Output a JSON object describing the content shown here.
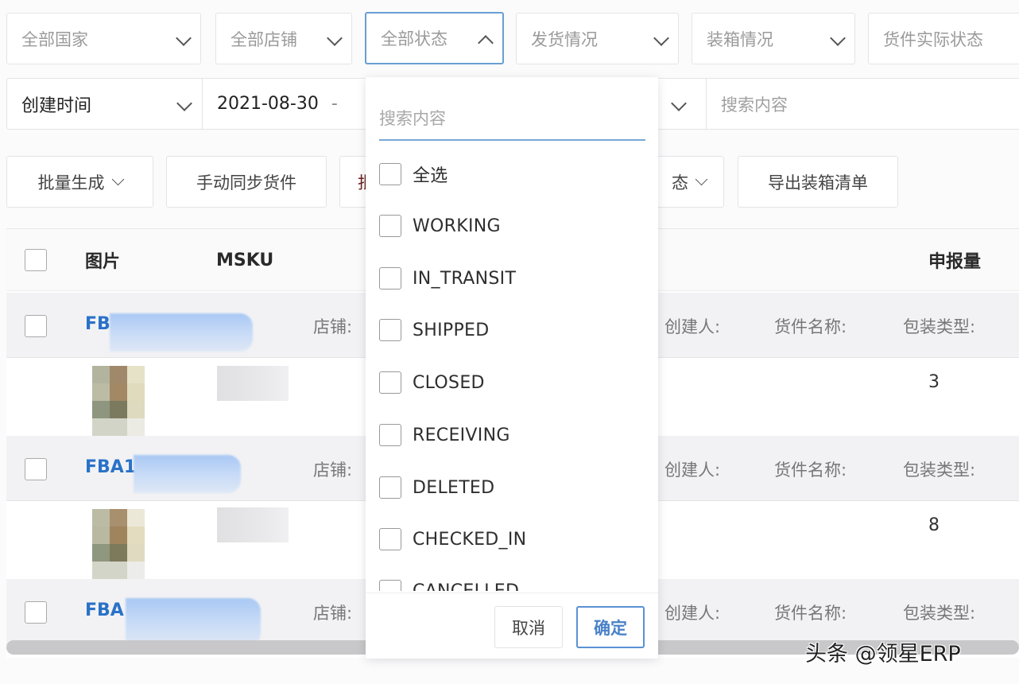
{
  "filters_row1": [
    {
      "label": "全部国家",
      "open": false
    },
    {
      "label": "全部店铺",
      "open": false
    },
    {
      "label": "全部状态",
      "open": true
    },
    {
      "label": "发货情况",
      "open": false
    },
    {
      "label": "装箱情况",
      "open": false
    },
    {
      "label": "货件实际状态",
      "open": false
    }
  ],
  "filters_row2": {
    "time_type": "创建时间",
    "date_start": "2021-08-30",
    "date_separator": "-",
    "search_placeholder": "搜索内容"
  },
  "toolbar": {
    "batch_generate": "批量生成",
    "manual_sync": "手动同步货件",
    "third_partial": "批",
    "status_partial": "态",
    "export_packing": "导出装箱清单"
  },
  "table": {
    "headers": {
      "image": "图片",
      "msku": "MSKU",
      "declared_qty": "申报量"
    },
    "groups": [
      {
        "shipment_id_prefix": "FB",
        "store_label": "店铺:",
        "creator_label": "创建人:",
        "shipment_name_label": "货件名称:",
        "package_type_label": "包装类型:",
        "declared_qty": "3"
      },
      {
        "shipment_id_prefix": "FBA1",
        "store_label": "店铺:",
        "creator_label": "创建人:",
        "shipment_name_label": "货件名称:",
        "package_type_label": "包装类型:",
        "declared_qty": "8"
      },
      {
        "shipment_id_prefix": "FBA",
        "store_label": "店铺:",
        "creator_label": "创建人:",
        "shipment_name_label": "货件名称:",
        "package_type_label": "包装类型:"
      }
    ]
  },
  "status_dropdown": {
    "search_placeholder": "搜索内容",
    "options": [
      {
        "label": "全选",
        "checked": false
      },
      {
        "label": "WORKING",
        "checked": false
      },
      {
        "label": "IN_TRANSIT",
        "checked": false
      },
      {
        "label": "SHIPPED",
        "checked": false
      },
      {
        "label": "CLOSED",
        "checked": false
      },
      {
        "label": "RECEIVING",
        "checked": false
      },
      {
        "label": "DELETED",
        "checked": false
      },
      {
        "label": "CHECKED_IN",
        "checked": false
      },
      {
        "label": "CANCELLED",
        "checked": false
      }
    ],
    "cancel_label": "取消",
    "confirm_label": "确定"
  },
  "watermark": "头条 @领星ERP",
  "colors": {
    "accent": "#4a82c8",
    "link": "#2a72c8",
    "focus_border": "#6a9fd3"
  }
}
